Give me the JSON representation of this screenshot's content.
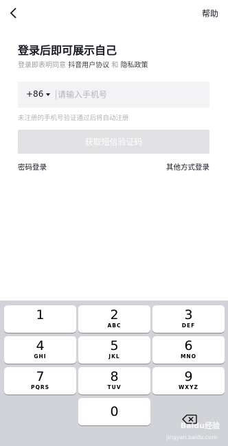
{
  "nav": {
    "help_label": "帮助",
    "back_icon": "back-chevron-icon"
  },
  "login": {
    "title": "登录后即可展示自己",
    "agreement_prefix": "登录即表明同意",
    "user_agreement": "抖音用户协议",
    "agreement_and": "和",
    "privacy_policy": "隐私政策",
    "country_code": "+86",
    "phone_placeholder": "请输入手机号",
    "phone_value": "",
    "hint": "未注册的手机号验证通过后将自动注册",
    "sms_button": "获取短信验证码",
    "password_login": "密码登录",
    "other_login": "其他方式登录"
  },
  "keypad": {
    "keys": [
      {
        "num": "1",
        "letters": ""
      },
      {
        "num": "2",
        "letters": "ABC"
      },
      {
        "num": "3",
        "letters": "DEF"
      },
      {
        "num": "4",
        "letters": "GHI"
      },
      {
        "num": "5",
        "letters": "JKL"
      },
      {
        "num": "6",
        "letters": "MNO"
      },
      {
        "num": "7",
        "letters": "PQRS"
      },
      {
        "num": "8",
        "letters": "TUV"
      },
      {
        "num": "9",
        "letters": "WXYZ"
      },
      {
        "num": "0",
        "letters": ""
      }
    ],
    "delete_icon": "backspace-icon"
  },
  "watermark": {
    "text": "Baidu经验",
    "sub": "jingyan.baidu.com"
  },
  "colors": {
    "button_disabled": "#e1e1e4",
    "keypad_bg": "#d1d3d9",
    "text": "#161823",
    "muted": "#9a9ba0"
  }
}
